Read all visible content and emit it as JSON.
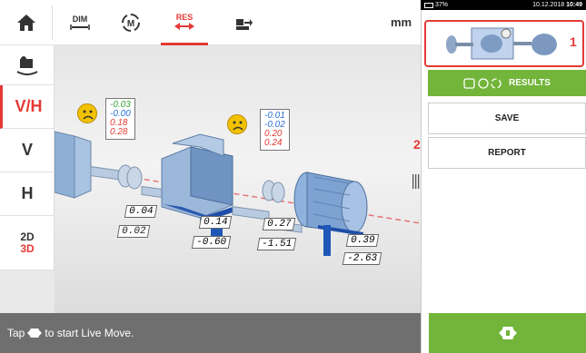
{
  "toolbar": {
    "dim_label": "DIM",
    "res_label": "RES",
    "unit_label": "mm"
  },
  "sidebar": {
    "vh_label": "V/H",
    "v_label": "V",
    "h_label": "H",
    "d2_label": "2D",
    "d3_label": "3D"
  },
  "statusbar": {
    "date": "10.12.2018",
    "time": "10:49",
    "battery": "37%"
  },
  "right_panel": {
    "thumb_marker": "1",
    "results_label": "RESULTS",
    "save_label": "SAVE",
    "report_marker": "2",
    "report_label": "REPORT"
  },
  "footer": {
    "hint_prefix": "Tap",
    "hint_suffix": "to start Live Move."
  },
  "gap_labels": {
    "left": {
      "v1": "-0.03",
      "v2": "-0.00",
      "v3": "0.18",
      "v4": "0.28"
    },
    "right": {
      "v1": "-0.01",
      "v2": "-0.02",
      "v3": "0.20",
      "v4": "0.24"
    }
  },
  "foot_values": {
    "gearbox": {
      "a": "0.04",
      "b": "0.14",
      "c": "0.02",
      "d": "-0.60"
    },
    "motor": {
      "a": "0.27",
      "b": "0.39",
      "c": "-1.51",
      "d": "-2.63"
    }
  },
  "colors": {
    "accent": "#e53935",
    "green": "#72b53a",
    "status": "#6f6f6f",
    "gap_green": "#3aa63a",
    "gap_blue": "#2a6fd6",
    "gap_red": "#e53935"
  }
}
